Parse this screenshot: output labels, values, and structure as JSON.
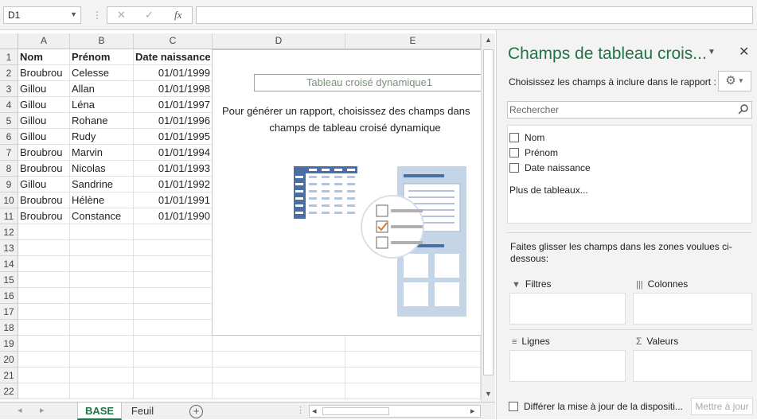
{
  "formula_bar": {
    "name_box": "D1",
    "separator": "⋮",
    "cancel_glyph": "✕",
    "enter_glyph": "✓",
    "fx_glyph": "fx",
    "formula_value": ""
  },
  "sheet": {
    "columns": [
      "A",
      "B",
      "C",
      "D",
      "E"
    ],
    "row_numbers": [
      "1",
      "2",
      "3",
      "4",
      "5",
      "6",
      "7",
      "8",
      "9",
      "10",
      "11",
      "12",
      "13",
      "14",
      "15",
      "16",
      "17",
      "18",
      "19",
      "20",
      "21",
      "22"
    ],
    "headers": [
      "Nom",
      "Prénom",
      "Date naissance"
    ],
    "rows": [
      [
        "Broubrou",
        "Celesse",
        "01/01/1999"
      ],
      [
        "Gillou",
        "Allan",
        "01/01/1998"
      ],
      [
        "Gillou",
        "Léna",
        "01/01/1997"
      ],
      [
        "Gillou",
        "Rohane",
        "01/01/1996"
      ],
      [
        "Gillou",
        "Rudy",
        "01/01/1995"
      ],
      [
        "Broubrou",
        "Marvin",
        "01/01/1994"
      ],
      [
        "Broubrou",
        "Nicolas",
        "01/01/1993"
      ],
      [
        "Gillou",
        "Sandrine",
        "01/01/1992"
      ],
      [
        "Broubrou",
        "Hélène",
        "01/01/1991"
      ],
      [
        "Broubrou",
        "Constance",
        "01/01/1990"
      ]
    ]
  },
  "pivot_placeholder": {
    "title": "Tableau croisé dynamique1",
    "message_line1": "Pour générer un rapport, choisissez des champs dans",
    "message_line2": "champs de tableau croisé dynamique"
  },
  "tabs": {
    "active": "BASE",
    "other": "Feuil",
    "add_glyph": "+",
    "nav_prev": "◂",
    "nav_next": "▸",
    "scroll_left": "◂",
    "scroll_right": "▸"
  },
  "pane": {
    "title": "Champs de tableau crois...",
    "subtitle": "Choisissez les champs à inclure dans le rapport :",
    "search_placeholder": "Rechercher",
    "fields": [
      "Nom",
      "Prénom",
      "Date naissance"
    ],
    "more_tables": "Plus de tableaux...",
    "drag_hint": "Faites glisser les champs dans les zones voulues ci-dessous:",
    "zones": {
      "filters": "Filtres",
      "columns": "Colonnes",
      "rows": "Lignes",
      "values": "Valeurs"
    },
    "defer_label": "Différer la mise à jour de la dispositi...",
    "update_button": "Mettre à jour"
  },
  "colors": {
    "accent_green": "#217346",
    "icon_blue": "#4a6fa5",
    "icon_light_blue": "#c5d5e8",
    "checkmark_orange": "#e07b25"
  }
}
